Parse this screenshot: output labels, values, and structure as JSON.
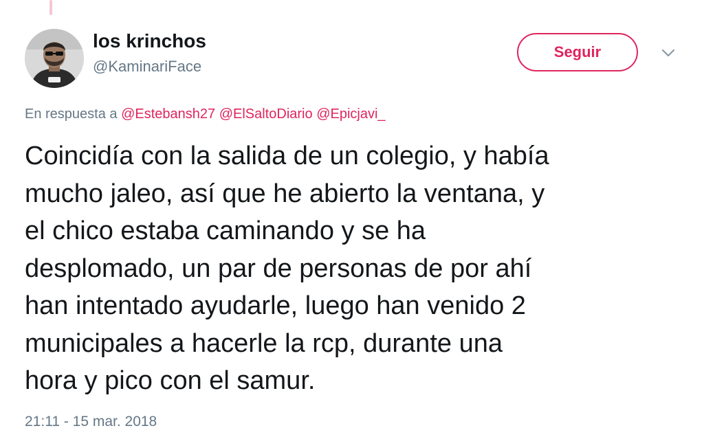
{
  "author": {
    "display_name": "los krinchos",
    "handle": "@KaminariFace"
  },
  "actions": {
    "follow_label": "Seguir",
    "menu_icon": "chevron-down-icon"
  },
  "reply": {
    "prefix": "En respuesta a",
    "mentions": [
      "@Estebansh27",
      "@ElSaltoDiario",
      "@Epicjavi_"
    ]
  },
  "tweet": {
    "lines": [
      "Coincidía con la salida de un colegio, y había",
      "mucho jaleo, así que he abierto la ventana, y",
      "el chico estaba caminando y se ha",
      "desplomado, un par de personas de por ahí",
      "han intentado ayudarle, luego han venido 2",
      "municipales a hacerle la rcp, durante una",
      "hora y pico con el samur."
    ],
    "timestamp": "21:11 - 15 mar. 2018"
  },
  "colors": {
    "accent": "#e0245e",
    "text": "#14171a",
    "secondary": "#657786"
  }
}
